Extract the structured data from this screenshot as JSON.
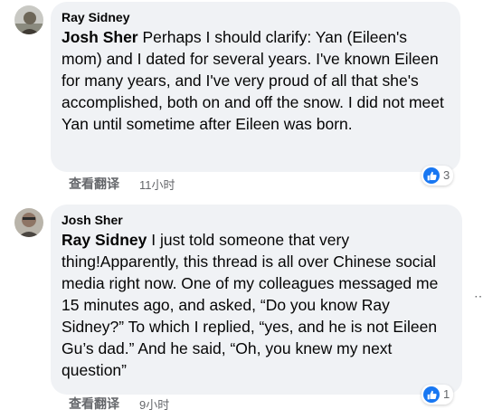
{
  "comments": [
    {
      "author": "Ray Sidney",
      "mention": "Josh Sher",
      "text": " Perhaps I should clarify: Yan (Eileen's mom) and I dated for several years. I've known Eileen for many years, and I've very proud of all that she's accomplished, both on and off the snow. I did not meet Yan until sometime after Eileen was born.",
      "translate_label": "查看翻译",
      "timestamp": "11小时",
      "reaction_count": "3"
    },
    {
      "author": "Josh Sher",
      "mention": "Ray Sidney",
      "text": " I just told someone that very thing!Apparently, this thread is all over Chinese social media right now. One of my colleagues messaged me 15 minutes ago, and asked, “Do you know Ray Sidney?” To which I replied, “yes, and he is not Eileen Gu’s dad.” And he said, “Oh, you knew my next question”",
      "translate_label": "查看翻译",
      "timestamp": "9小时",
      "reaction_count": "1"
    }
  ],
  "colors": {
    "bubble": "#f0f2f5",
    "like_blue": "#1877f2",
    "meta_gray": "#65676b"
  },
  "icons": {
    "reaction": "thumbs-up-icon",
    "more": "more-options-icon"
  }
}
